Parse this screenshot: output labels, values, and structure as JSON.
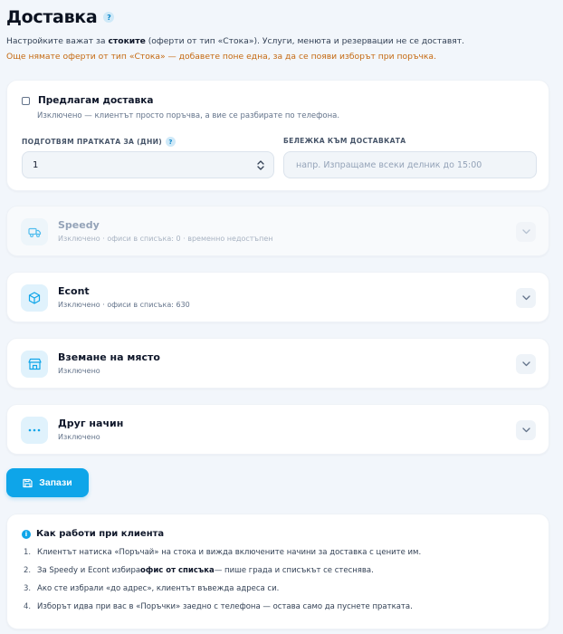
{
  "header": {
    "title": "Доставка",
    "help": "?",
    "subtitle_pre": "Настройките важат за ",
    "subtitle_bold": "стоките",
    "subtitle_post": " (оферти от тип «Стока»). Услуги, менюта и резервации не се доставят.",
    "warning": "Още нямате оферти от тип «Стока» — добавете поне една, за да се появи изборът при поръчка."
  },
  "main": {
    "checkbox_label": "Предлагам доставка",
    "checkbox_desc": "Изключено — клиентът просто поръчва, а вие се разбирате по телефона.",
    "prep_label": "ПОДГОТВЯМ ПРАТКАТА ЗА (ДНИ)",
    "prep_help": "?",
    "prep_value": "1",
    "note_label": "БЕЛЕЖКА КЪМ ДОСТАВКАТА",
    "note_placeholder": "напр. Изпращаме всеки делник до 15:00"
  },
  "methods": [
    {
      "name": "Speedy",
      "desc": "Изключено · офиси в списъка: 0 · временно недостъпен",
      "icon": "truck-icon",
      "disabled": true
    },
    {
      "name": "Econt",
      "desc": "Изключено · офиси в списъка: 630",
      "icon": "package-icon",
      "disabled": false
    },
    {
      "name": "Вземане на място",
      "desc": "Изключено",
      "icon": "store-icon",
      "disabled": false
    },
    {
      "name": "Друг начин",
      "desc": "Изключено",
      "icon": "more-icon",
      "disabled": false
    }
  ],
  "save_label": "Запази",
  "info": {
    "title": "Как работи при клиента",
    "icon": "i",
    "steps": [
      {
        "n": "1.",
        "pre": "Клиентът натиска «Поръчай» на стока и вижда включените начини за доставка с цените им.",
        "bold": "",
        "post": ""
      },
      {
        "n": "2.",
        "pre": "За Speedy и Econt избира ",
        "bold": "офис от списъка",
        "post": " — пише града и списъкът се стеснява."
      },
      {
        "n": "3.",
        "pre": "Ако сте избрали «до адрес», клиентът въвежда адреса си.",
        "bold": "",
        "post": ""
      },
      {
        "n": "4.",
        "pre": "Изборът идва при вас в «Поръчки» заедно с телефона — остава само да пуснете пратката.",
        "bold": "",
        "post": ""
      }
    ]
  },
  "colors": {
    "accent": "#0ea5e9",
    "warning": "#c56a12",
    "background": "#f2f6fb"
  }
}
